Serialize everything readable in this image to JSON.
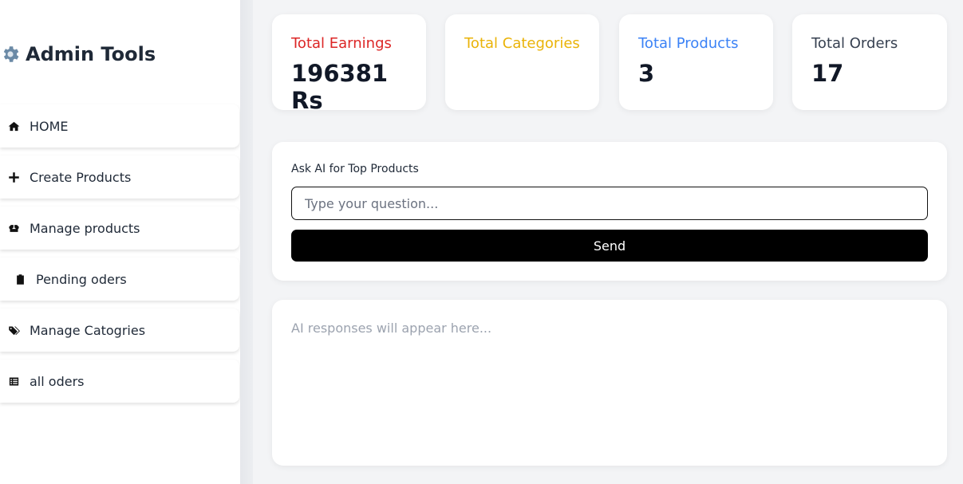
{
  "sidebar": {
    "brand": "Admin Tools",
    "brand_icon": "gear-icon",
    "items": [
      {
        "label": "HOME",
        "icon": "home-icon"
      },
      {
        "label": "Create Products",
        "icon": "plus-icon"
      },
      {
        "label": "Manage products",
        "icon": "boxes-icon"
      },
      {
        "label": "Pending oders",
        "icon": "clipboard-icon"
      },
      {
        "label": "Manage Catogries",
        "icon": "tags-icon"
      },
      {
        "label": "all oders",
        "icon": "list-icon"
      }
    ]
  },
  "stats": [
    {
      "label": "Total Earnings",
      "value": "196381 Rs",
      "color": "#dc2626"
    },
    {
      "label": "Total Categories",
      "value": "",
      "color": "#eab308"
    },
    {
      "label": "Total Products",
      "value": "3",
      "color": "#3b82f6"
    },
    {
      "label": "Total Orders",
      "value": "17",
      "color": "#374151"
    }
  ],
  "ask": {
    "label": "Ask AI for Top Products",
    "placeholder": "Type your question...",
    "value": "",
    "send_label": "Send"
  },
  "response": {
    "placeholder": "AI responses will appear here..."
  }
}
